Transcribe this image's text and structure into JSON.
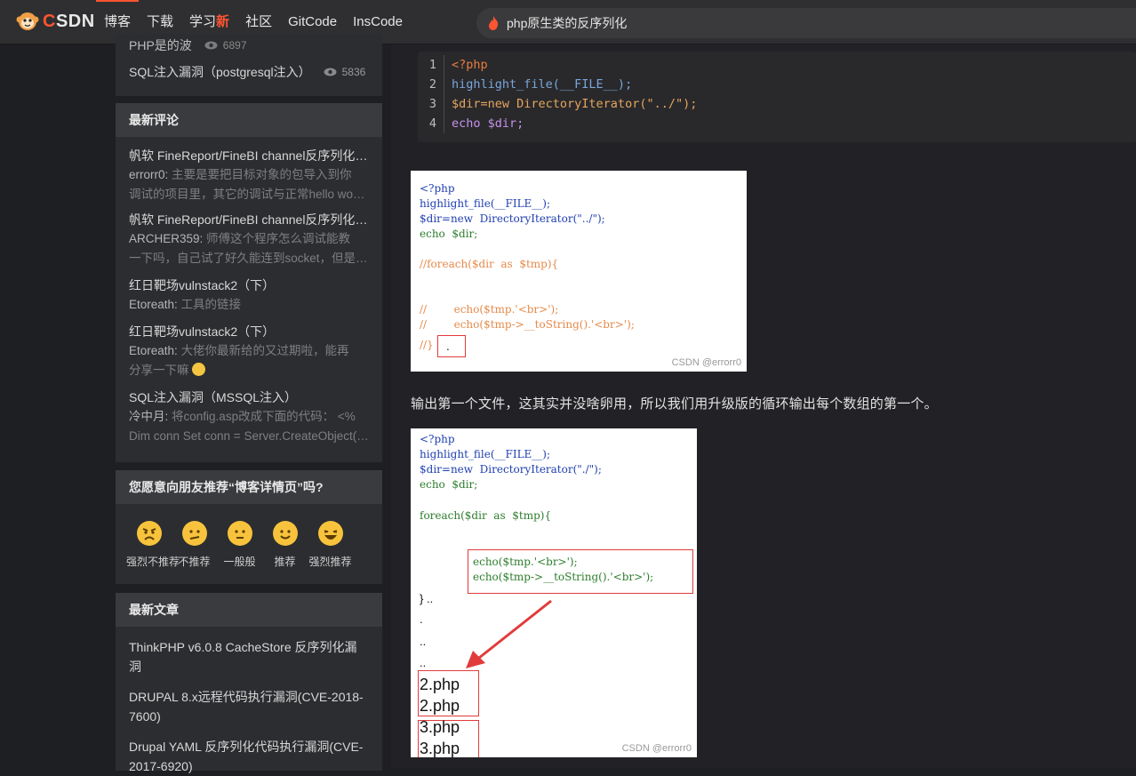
{
  "topbar": {
    "brand": "CSDN",
    "nav": [
      {
        "label": "博客",
        "active": true
      },
      {
        "label": "下载"
      },
      {
        "label": "学习",
        "badge": "新"
      },
      {
        "label": "社区"
      },
      {
        "label": "GitCode"
      },
      {
        "label": "InsCode"
      }
    ],
    "search_query": "php原生类的反序列化"
  },
  "sidebar": {
    "hot_articles": [
      {
        "title": "PHP是的波",
        "views": "6897"
      },
      {
        "title": "SQL注入漏洞（postgresql注入）",
        "views": "5836"
      }
    ],
    "comments_title": "最新评论",
    "comments": [
      {
        "title": "帆软 FineReport/FineBI channel反序列化漏洞",
        "user": "errorr0:",
        "lines": [
          "主要是要把目标对象的包导入到你",
          "调试的项目里，其它的调试与正常hello world一样"
        ]
      },
      {
        "title": "帆软 FineReport/FineBI channel反序列化漏洞",
        "user": "ARCHER359:",
        "lines": [
          "师傅这个程序怎么调试能教",
          "一下吗，自己试了好久能连到socket，但是断点就不行"
        ]
      },
      {
        "title": "红日靶场vulnstack2（下）",
        "user": "Etoreath:",
        "lines": [
          "工具的链接"
        ]
      },
      {
        "title": "红日靶场vulnstack2（下）",
        "user": "Etoreath:",
        "lines": [
          "大佬你最新给的又过期啦，能再",
          "分享一下嘛"
        ]
      },
      {
        "title": "SQL注入漏洞（MSSQL注入）",
        "user": "冷中月:",
        "lines": [
          "将config.asp改成下面的代码： <%",
          "Dim conn Set conn = Server.CreateObject(\"ADODB.Connection\")"
        ]
      }
    ],
    "recommend_title": "您愿意向朋友推荐“博客详情页”吗?",
    "recommend_options": [
      "强烈不推荐",
      "不推荐",
      "一般般",
      "推荐",
      "强烈推荐"
    ],
    "latest_title": "最新文章",
    "latest_articles": [
      [
        "ThinkPHP v6.0.8 CacheStore 反序列化漏洞"
      ],
      [
        "DRUPAL 8.x远程代码执行漏洞(CVE-2018-",
        "7600)"
      ],
      [
        "Drupal YAML 反序列化代码执行漏洞(CVE-",
        "2017-6920)"
      ]
    ]
  },
  "content": {
    "code": [
      {
        "n": "1",
        "text": "<?php"
      },
      {
        "n": "2",
        "text": "highlight_file(__FILE__);"
      },
      {
        "n": "3",
        "text": "$dir=new DirectoryIterator(\"../\");"
      },
      {
        "n": "4",
        "text": "echo $dir;"
      }
    ],
    "shot1": {
      "lines": [
        "<?php",
        "highlight_file(__FILE__);",
        "$dir=new  DirectoryIterator(\"../\");",
        "echo  $dir;",
        "//foreach($dir  as  $tmp){",
        "//        echo($tmp.'<br>');",
        "//        echo($tmp->__toString().'<br>');",
        "//}",
        "."
      ],
      "watermark": "CSDN @errorr0"
    },
    "paragraph": "输出第一个文件，这其实并没啥卵用，所以我们用升级版的循环输出每个数组的第一个。",
    "shot2": {
      "lines": [
        "<?php",
        "highlight_file(__FILE__);",
        "$dir=new  DirectoryIterator(\"./\");",
        "echo  $dir;",
        "foreach($dir  as  $tmp){",
        "echo($tmp.'<br>');",
        "echo($tmp->__toString().'<br>');",
        "} ..",
        ".",
        "..",
        "..",
        "2.php",
        "2.php",
        "3.php",
        "3.php"
      ],
      "watermark": "CSDN @errorr0"
    }
  },
  "colors": {
    "accent": "#fc5531",
    "bg": "#1e1f22",
    "panel": "#2c2d30"
  }
}
